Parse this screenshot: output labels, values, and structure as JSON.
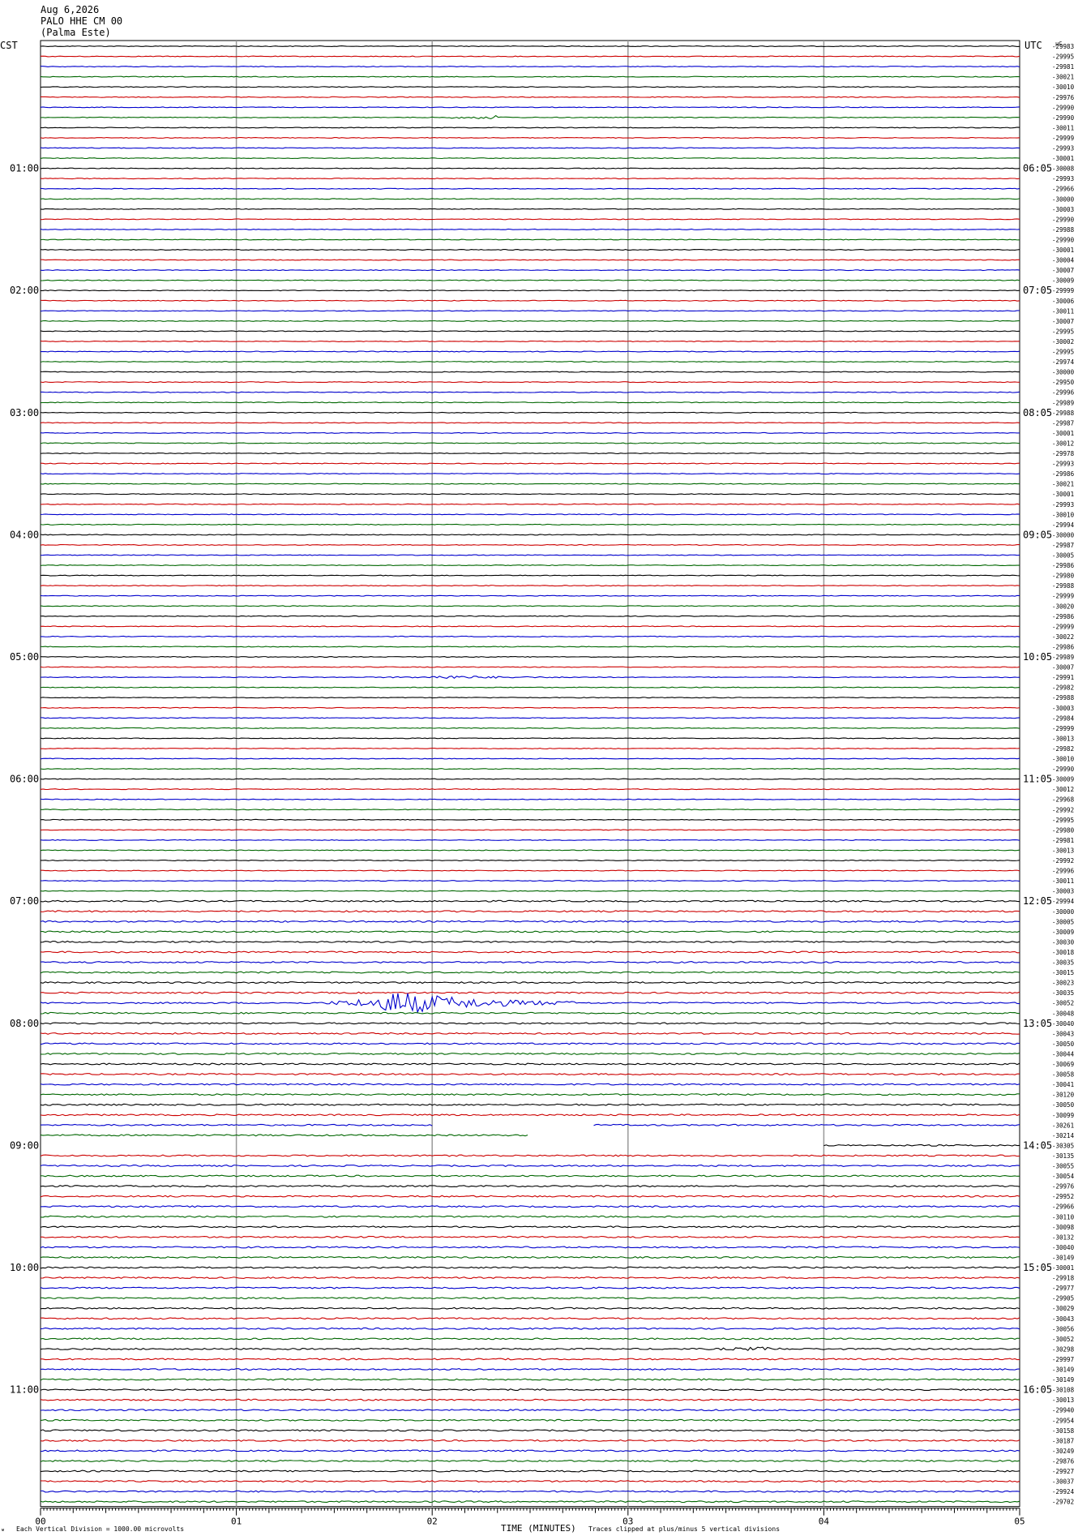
{
  "header": {
    "date": "Aug 6,2026",
    "station": "PALO HHE CM 00",
    "location": "(Palma Este)"
  },
  "left_timezone": "CST",
  "right_timezone": "UTC",
  "right_unit": "μC",
  "footer": {
    "scale_note": "Each Vertical Division = 1000.00 microvolts",
    "xlabel": "TIME (MINUTES)",
    "clip_note": "Traces clipped at plus/minus 5 vertical divisions"
  },
  "colors": {
    "cycle": [
      "#000000",
      "#cc0000",
      "#0000cc",
      "#006600"
    ],
    "grid": "#999999"
  },
  "chart_data": {
    "type": "line",
    "title": "",
    "xlabel": "TIME (MINUTES)",
    "xlim": [
      0,
      5
    ],
    "x_ticks": [
      "00",
      "01",
      "02",
      "03",
      "04",
      "05"
    ],
    "rows": 144,
    "rows_per_hour": 12,
    "left_hour_labels": [
      "01:00",
      "02:00",
      "03:00",
      "04:00",
      "05:00",
      "06:00",
      "07:00",
      "08:00",
      "09:00",
      "10:00",
      "11:00"
    ],
    "left_first_label_row": 12,
    "right_hour_labels": [
      "06:05",
      "07:05",
      "08:05",
      "09:05",
      "10:05",
      "11:05",
      "12:05",
      "13:05",
      "14:05",
      "15:05",
      "16:05"
    ],
    "right_first_label_row": 12,
    "row_offsets": [
      "-29983",
      "-29995",
      "-29981",
      "-30021",
      "-30010",
      "-29976",
      "-29990",
      "-29990",
      "-30011",
      "-29999",
      "-29993",
      "-30001",
      "-30008",
      "-29993",
      "-29966",
      "-30000",
      "-30003",
      "-29990",
      "-29988",
      "-29990",
      "-30001",
      "-30004",
      "-30007",
      "-30009",
      "-29999",
      "-30006",
      "-30011",
      "-30007",
      "-29995",
      "-30002",
      "-29995",
      "-29974",
      "-30000",
      "-29950",
      "-29996",
      "-29989",
      "-29988",
      "-29987",
      "-30001",
      "-30012",
      "-29978",
      "-29993",
      "-29986",
      "-30021",
      "-30001",
      "-29993",
      "-30010",
      "-29994",
      "-30000",
      "-29987",
      "-30005",
      "-29986",
      "-29980",
      "-29988",
      "-29999",
      "-30020",
      "-29986",
      "-29999",
      "-30022",
      "-29986",
      "-29989",
      "-30007",
      "-29991",
      "-29982",
      "-29988",
      "-30003",
      "-29984",
      "-29999",
      "-30013",
      "-29982",
      "-30010",
      "-29990",
      "-30009",
      "-30012",
      "-29968",
      "-29992",
      "-29995",
      "-29980",
      "-29981",
      "-30013",
      "-29992",
      "-29996",
      "-30011",
      "-30003",
      "-29994",
      "-30000",
      "-30005",
      "-30009",
      "-30030",
      "-30018",
      "-30035",
      "-30015",
      "-30023",
      "-30035",
      "-30052",
      "-30048",
      "-30040",
      "-30043",
      "-30050",
      "-30044",
      "-30069",
      "-30058",
      "-30041",
      "-30120",
      "-30050",
      "-30099",
      "-30261",
      "-30214",
      "-30305",
      "-30135",
      "-30055",
      "-30054",
      "-29976",
      "-29952",
      "-29966",
      "-30110",
      "-30098",
      "-30132",
      "-30040",
      "-30149",
      "-30001",
      "-29918",
      "-29977",
      "-29905",
      "-30029",
      "-30043",
      "-30056",
      "-30052",
      "-30298",
      "-29997",
      "-30149",
      "-30149",
      "-30108",
      "-30013",
      "-29940",
      "-29954",
      "-30158",
      "-30187",
      "-30249",
      "-29876",
      "-29927",
      "-30037",
      "-29924",
      "-29702"
    ],
    "events": [
      {
        "row": 7,
        "minute": 2.3,
        "duration": 0.1,
        "amplitude": 4
      },
      {
        "row": 62,
        "minute": 2.0,
        "duration": 0.9,
        "amplitude": 2
      },
      {
        "row": 94,
        "minute": 1.75,
        "duration": 1.0,
        "amplitude": 18
      },
      {
        "row": 128,
        "minute": 3.73,
        "duration": 0.05,
        "amplitude": 5
      }
    ],
    "gaps": [
      {
        "row": 106,
        "from_minute": 2.0,
        "to_minute": 2.82
      },
      {
        "row": 107,
        "from_minute": 2.5,
        "to_minute": 5.0
      },
      {
        "row": 108,
        "from_minute": 0.0,
        "to_minute": 4.0
      }
    ]
  }
}
